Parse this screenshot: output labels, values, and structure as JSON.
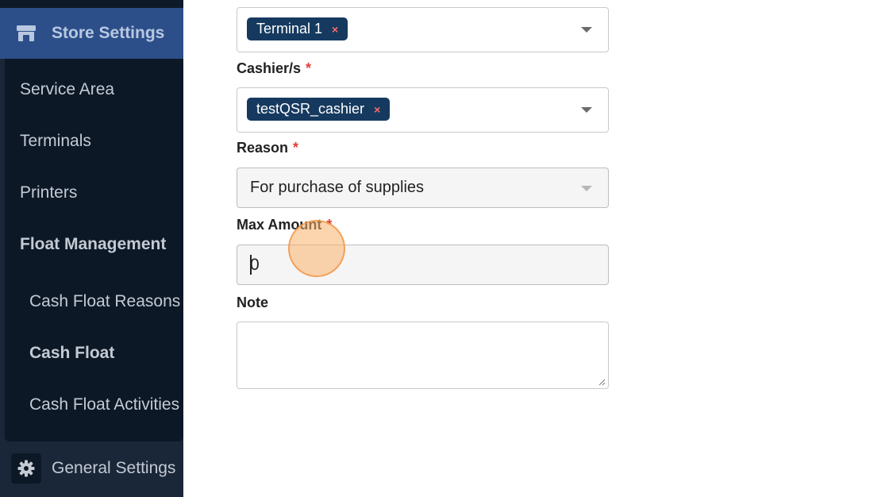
{
  "sidebar": {
    "store_settings": {
      "label": "Store Settings",
      "icon": "store-icon"
    },
    "items": [
      {
        "label": "Service Area"
      },
      {
        "label": "Terminals"
      },
      {
        "label": "Printers"
      },
      {
        "label": "Float Management"
      },
      {
        "label": "Cash Float Reasons"
      },
      {
        "label": "Cash Float"
      },
      {
        "label": "Cash Float Activities"
      }
    ],
    "general_settings": {
      "label": "General Settings",
      "icon": "gear-icon"
    }
  },
  "form": {
    "terminal": {
      "tag": "Terminal 1",
      "remove": "×"
    },
    "cashiers": {
      "label": "Cashier/s",
      "required": "*",
      "tag": "testQSR_cashier",
      "remove": "×"
    },
    "reason": {
      "label": "Reason",
      "required": "*",
      "value": "For purchase of supplies"
    },
    "max_amount": {
      "label": "Max Amount",
      "required": "*",
      "value": "0"
    },
    "note": {
      "label": "Note",
      "value": ""
    }
  },
  "colors": {
    "sidebar_bg": "#1a2738",
    "active_bg": "#2c4f8a",
    "tag_bg": "#163a5f",
    "required": "#e0403a"
  }
}
